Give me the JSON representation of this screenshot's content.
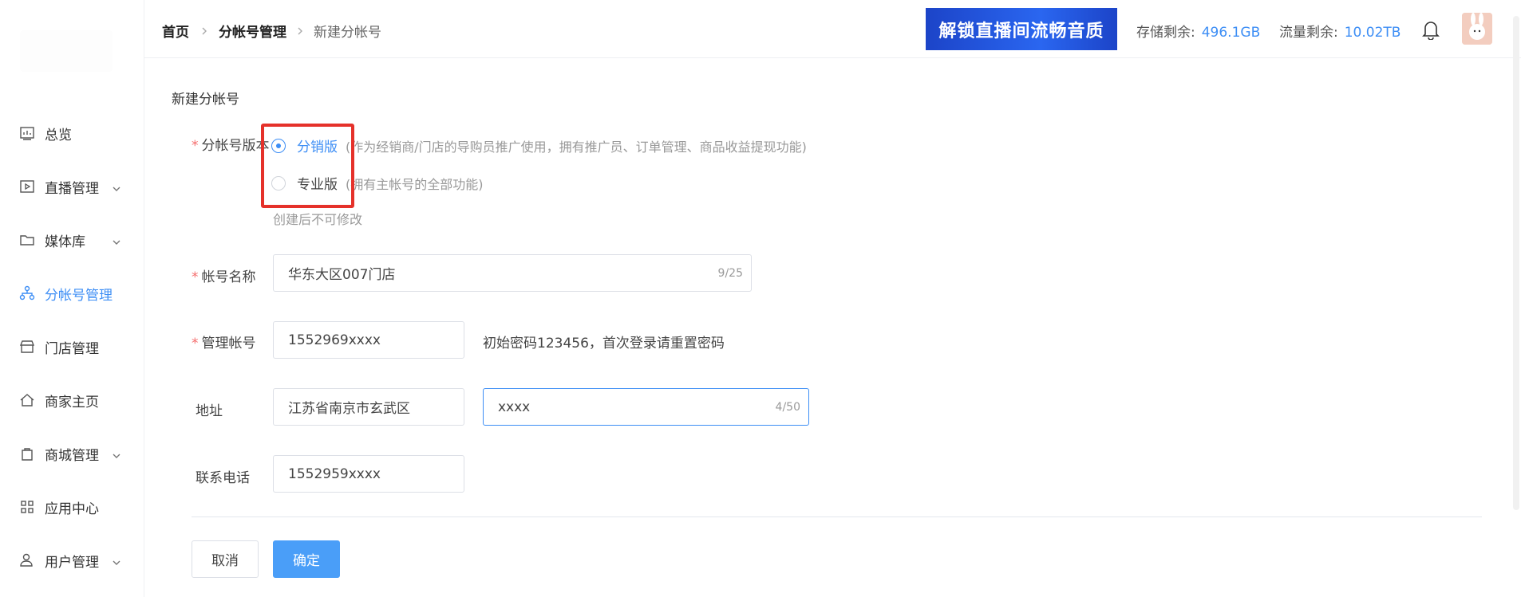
{
  "sidebar": {
    "items": [
      {
        "label": "总览",
        "icon": "chart-board-icon",
        "has_chevron": false,
        "active": false
      },
      {
        "label": "直播管理",
        "icon": "live-play-icon",
        "has_chevron": true,
        "active": false
      },
      {
        "label": "媒体库",
        "icon": "folder-icon",
        "has_chevron": true,
        "active": false
      },
      {
        "label": "分帐号管理",
        "icon": "org-tree-icon",
        "has_chevron": false,
        "active": true
      },
      {
        "label": "门店管理",
        "icon": "store-icon",
        "has_chevron": false,
        "active": false
      },
      {
        "label": "商家主页",
        "icon": "home-icon",
        "has_chevron": false,
        "active": false
      },
      {
        "label": "商城管理",
        "icon": "shopping-bag-icon",
        "has_chevron": true,
        "active": false
      },
      {
        "label": "应用中心",
        "icon": "apps-grid-icon",
        "has_chevron": false,
        "active": false
      },
      {
        "label": "用户管理",
        "icon": "user-settings-icon",
        "has_chevron": true,
        "active": false
      }
    ]
  },
  "breadcrumb": {
    "home": "首页",
    "parent": "分帐号管理",
    "current": "新建分帐号"
  },
  "header": {
    "banner_text": "解锁直播间流畅音质",
    "storage_label": "存储剩余:",
    "storage_value": "496.1GB",
    "traffic_label": "流量剩余:",
    "traffic_value": "10.02TB"
  },
  "form": {
    "title": "新建分帐号",
    "version_label": "分帐号版本",
    "version_options": [
      {
        "label": "分销版",
        "desc": "(作为经销商/门店的导购员推广使用，拥有推广员、订单管理、商品收益提现功能)",
        "selected": true
      },
      {
        "label": "专业版",
        "desc": "(拥有主帐号的全部功能)",
        "selected": false
      }
    ],
    "version_hint": "创建后不可修改",
    "name_label": "帐号名称",
    "name_value": "华东大区007门店",
    "name_count": "9/25",
    "account_label": "管理帐号",
    "account_value": "1552969xxxx",
    "account_note": "初始密码123456，首次登录请重置密码",
    "address_label": "地址",
    "address_region": "江苏省南京市玄武区",
    "address_detail": "xxxx",
    "address_count": "4/50",
    "phone_label": "联系电话",
    "phone_value": "1552959xxxx",
    "required_mark": "*",
    "cancel_label": "取消",
    "confirm_label": "确定"
  },
  "colors": {
    "accent": "#3d8ef5",
    "required": "#f56c6c",
    "highlight_box": "#e5312a",
    "primary_button": "#4a9ef8"
  }
}
